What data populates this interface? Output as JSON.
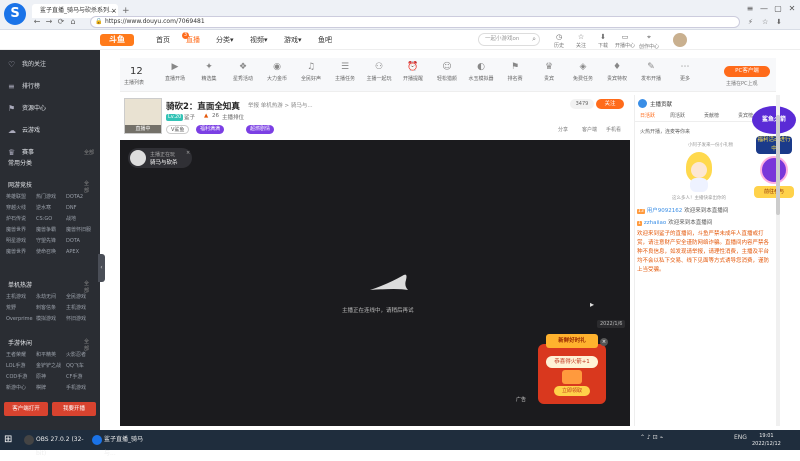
{
  "browser": {
    "tab_title": "鲨子直播_骑马与砍杀系列...",
    "tab_close": "×",
    "tab_add": "+",
    "url": "https://www.douyu.com/7069481",
    "win": [
      "≡",
      "—",
      "▢",
      "✕"
    ],
    "nav": [
      "←",
      "→",
      "⟳",
      "⌂"
    ]
  },
  "site": {
    "logo": "斗鱼",
    "nav": [
      "首页",
      "直播",
      "分类",
      "视频",
      "游戏",
      "鱼吧"
    ],
    "nav_badge": "3",
    "search_placeholder": "一起小游戏on",
    "icons": [
      {
        "icon": "bell-icon",
        "label": "历史"
      },
      {
        "icon": "star-icon",
        "label": "关注"
      },
      {
        "icon": "download-icon",
        "label": "下载"
      },
      {
        "icon": "monitor-icon",
        "label": "开播中心"
      },
      {
        "icon": "location-icon",
        "label": "创作中心"
      }
    ]
  },
  "sidebar": {
    "items": [
      {
        "icon": "heart-icon",
        "label": "我的关注"
      },
      {
        "icon": "list-icon",
        "label": "排行榜"
      },
      {
        "icon": "flag-icon",
        "label": "资源中心"
      },
      {
        "icon": "cloud-icon",
        "label": "云游戏"
      },
      {
        "icon": "trophy-icon",
        "label": "赛事"
      }
    ],
    "sec_common": "常用分类",
    "sec_online": "网游竞技",
    "online_games": [
      "英雄联盟",
      "热门游戏",
      "DOTA2",
      "穿越火线",
      "逆水寒",
      "DNF",
      "炉石传说",
      "CS:GO",
      "战地",
      "魔兽世界",
      "魔兽争霸",
      "魔兽怀旧服",
      "明星游戏",
      "守望先锋",
      "DOTA",
      "魔兽世界",
      "使命召唤",
      "APEX"
    ],
    "sec_single": "单机热游",
    "single_games": [
      "主机游戏",
      "永劫无间",
      "全民游戏",
      "荒野",
      "刺客信条",
      "主机游戏",
      "Overprime",
      "模拟游戏",
      "怀旧游戏"
    ],
    "sec_mobile": "手游休闲",
    "mobile_games": [
      "王者荣耀",
      "和平精英",
      "火影忍者",
      "LOL手游",
      "金铲铲之战",
      "QQ飞车",
      "COD手游",
      "原神",
      "CF手游",
      "新游中心",
      "棋牌",
      "手机游戏"
    ],
    "more_label": "全部",
    "btn_left": "客户端打开",
    "btn_right": "我要开播",
    "toggle": "‹"
  },
  "catrow": {
    "count": "12",
    "count_label": "主播列表",
    "items": [
      "直播开场",
      "精选集",
      "星秀活动",
      "大力金币",
      "全民好声",
      "主播任务",
      "主播一起玩",
      "开播提醒",
      "轻松猎颜",
      "水玉模拟器",
      "排名赛",
      "贵宾",
      "免费任务",
      "贵宾特权",
      "发布开播",
      "更多"
    ],
    "pc_btn": "PC客户端",
    "pc_sub": "主播在PC上观"
  },
  "stream": {
    "title": "骑砍2：直面全知真",
    "meta": "举报  单机热游 > 骑马与...",
    "lvl": "Lv.20",
    "streamer": "鲨子",
    "score": "26",
    "score_label": "主播排位",
    "tags": [
      "V鲨鱼",
      "福利满满",
      "超燃剧情"
    ],
    "follow_count": "3479",
    "follow": "关注",
    "avatar_label": "直播中",
    "mini_actions": [
      "分享",
      "客户端",
      "手机看"
    ]
  },
  "player": {
    "tag_label": "主播正在玩",
    "tag_game": "骑马与砍杀",
    "tag_x": "×",
    "error_text": "主播正在连线中，请稍后再试",
    "time": "2022/1/6",
    "ad_label": "广告",
    "promo_header": "新鲜好时礼",
    "promo_amount": "恭喜得火箭+1",
    "promo_cta": "立即领取",
    "promo_close": "×"
  },
  "right": {
    "header": "主播贡献",
    "tabs": [
      "日活跃",
      "周活跃",
      "贡献榜",
      "贵宾榜"
    ],
    "note": "火热开播，连麦等你来",
    "small1": "小阿子发来一份小礼物",
    "small2": "这么多人！主播快拿出你的",
    "ad_top": "鲨鱼火箭",
    "ad_mid": "福利活动进行中",
    "ad_btm": "前往参与",
    "chat": [
      {
        "lv": "13",
        "name": "用户9092162",
        "text": "欢迎来到本直播间"
      },
      {
        "lv": "1",
        "name": "zzhaiiao",
        "text": "欢迎来到本直播间"
      }
    ],
    "sys_msg": "欢迎来到鲨子的直播间，斗鱼严禁未成年人直播或打赏，请注意财产安全谨防网络诈骗。直播间内容严禁各种不良信息，如发现请举报，请理性消费，主播及平台均不会以私下交易、线下见面等方式诱导您消费，谨防上当受骗。"
  },
  "taskbar": {
    "items": [
      {
        "label": "OBS 27.0.2 (32-bit)",
        "color": "#444"
      },
      {
        "label": "鲨子直播_骑马与...",
        "color": "#1a73e8"
      }
    ],
    "lang": "ENG",
    "time": "19:01",
    "date": "2022/12/12"
  }
}
